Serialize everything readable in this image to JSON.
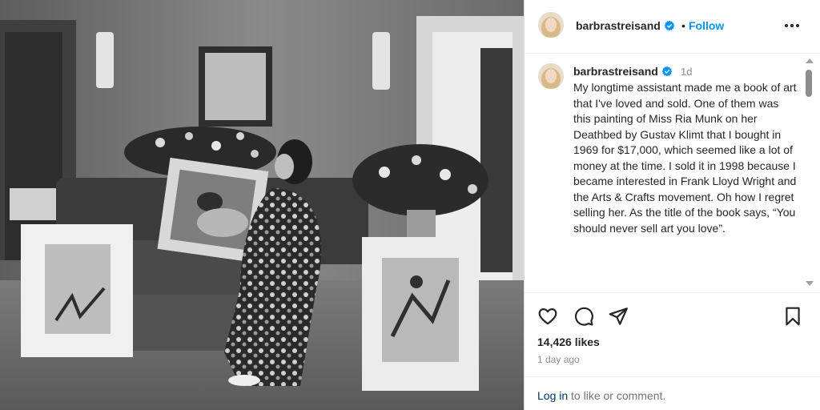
{
  "post": {
    "photo_alt": "Black and white photo of a woman in a patterned dress seated on a sofa beside framed artworks and flowers",
    "author": {
      "username": "barbrastreisand",
      "verified": true
    },
    "header": {
      "separator": "•",
      "follow_label": "Follow"
    },
    "caption": {
      "username": "barbrastreisand",
      "time": "1d",
      "text": "My longtime assistant made me a book of art that I've loved and sold. One of them was this painting of Miss Ria Munk on her Deathbed by Gustav Klimt that I bought in 1969 for $17,000, which seemed like a lot of money at the time. I sold it in 1998 because I became interested in Frank Lloyd Wright and the Arts & Crafts movement. Oh how I regret selling her.  As the title of the book says, “You should never sell art you love”."
    },
    "stats": {
      "likes": "14,426 likes",
      "posted": "1 day ago"
    },
    "login": {
      "link": "Log in",
      "rest": " to like or comment."
    }
  },
  "icons": {
    "verified": "verified-badge-icon",
    "more": "more-options-icon",
    "like": "heart-icon",
    "comment": "comment-icon",
    "share": "share-icon",
    "save": "bookmark-icon"
  },
  "colors": {
    "accent": "#0095f6",
    "verified": "#0095f6",
    "link": "#00376b",
    "muted": "#8e8e8e"
  }
}
